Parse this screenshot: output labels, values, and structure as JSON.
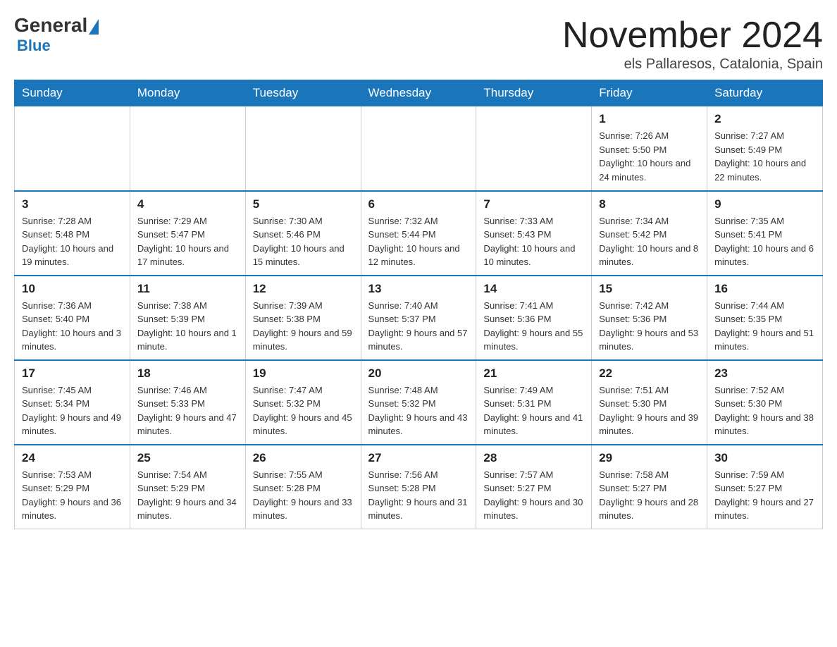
{
  "logo": {
    "general": "General",
    "blue": "Blue"
  },
  "title": "November 2024",
  "location": "els Pallaresos, Catalonia, Spain",
  "weekdays": [
    "Sunday",
    "Monday",
    "Tuesday",
    "Wednesday",
    "Thursday",
    "Friday",
    "Saturday"
  ],
  "weeks": [
    [
      {
        "day": "",
        "sunrise": "",
        "sunset": "",
        "daylight": ""
      },
      {
        "day": "",
        "sunrise": "",
        "sunset": "",
        "daylight": ""
      },
      {
        "day": "",
        "sunrise": "",
        "sunset": "",
        "daylight": ""
      },
      {
        "day": "",
        "sunrise": "",
        "sunset": "",
        "daylight": ""
      },
      {
        "day": "",
        "sunrise": "",
        "sunset": "",
        "daylight": ""
      },
      {
        "day": "1",
        "sunrise": "Sunrise: 7:26 AM",
        "sunset": "Sunset: 5:50 PM",
        "daylight": "Daylight: 10 hours and 24 minutes."
      },
      {
        "day": "2",
        "sunrise": "Sunrise: 7:27 AM",
        "sunset": "Sunset: 5:49 PM",
        "daylight": "Daylight: 10 hours and 22 minutes."
      }
    ],
    [
      {
        "day": "3",
        "sunrise": "Sunrise: 7:28 AM",
        "sunset": "Sunset: 5:48 PM",
        "daylight": "Daylight: 10 hours and 19 minutes."
      },
      {
        "day": "4",
        "sunrise": "Sunrise: 7:29 AM",
        "sunset": "Sunset: 5:47 PM",
        "daylight": "Daylight: 10 hours and 17 minutes."
      },
      {
        "day": "5",
        "sunrise": "Sunrise: 7:30 AM",
        "sunset": "Sunset: 5:46 PM",
        "daylight": "Daylight: 10 hours and 15 minutes."
      },
      {
        "day": "6",
        "sunrise": "Sunrise: 7:32 AM",
        "sunset": "Sunset: 5:44 PM",
        "daylight": "Daylight: 10 hours and 12 minutes."
      },
      {
        "day": "7",
        "sunrise": "Sunrise: 7:33 AM",
        "sunset": "Sunset: 5:43 PM",
        "daylight": "Daylight: 10 hours and 10 minutes."
      },
      {
        "day": "8",
        "sunrise": "Sunrise: 7:34 AM",
        "sunset": "Sunset: 5:42 PM",
        "daylight": "Daylight: 10 hours and 8 minutes."
      },
      {
        "day": "9",
        "sunrise": "Sunrise: 7:35 AM",
        "sunset": "Sunset: 5:41 PM",
        "daylight": "Daylight: 10 hours and 6 minutes."
      }
    ],
    [
      {
        "day": "10",
        "sunrise": "Sunrise: 7:36 AM",
        "sunset": "Sunset: 5:40 PM",
        "daylight": "Daylight: 10 hours and 3 minutes."
      },
      {
        "day": "11",
        "sunrise": "Sunrise: 7:38 AM",
        "sunset": "Sunset: 5:39 PM",
        "daylight": "Daylight: 10 hours and 1 minute."
      },
      {
        "day": "12",
        "sunrise": "Sunrise: 7:39 AM",
        "sunset": "Sunset: 5:38 PM",
        "daylight": "Daylight: 9 hours and 59 minutes."
      },
      {
        "day": "13",
        "sunrise": "Sunrise: 7:40 AM",
        "sunset": "Sunset: 5:37 PM",
        "daylight": "Daylight: 9 hours and 57 minutes."
      },
      {
        "day": "14",
        "sunrise": "Sunrise: 7:41 AM",
        "sunset": "Sunset: 5:36 PM",
        "daylight": "Daylight: 9 hours and 55 minutes."
      },
      {
        "day": "15",
        "sunrise": "Sunrise: 7:42 AM",
        "sunset": "Sunset: 5:36 PM",
        "daylight": "Daylight: 9 hours and 53 minutes."
      },
      {
        "day": "16",
        "sunrise": "Sunrise: 7:44 AM",
        "sunset": "Sunset: 5:35 PM",
        "daylight": "Daylight: 9 hours and 51 minutes."
      }
    ],
    [
      {
        "day": "17",
        "sunrise": "Sunrise: 7:45 AM",
        "sunset": "Sunset: 5:34 PM",
        "daylight": "Daylight: 9 hours and 49 minutes."
      },
      {
        "day": "18",
        "sunrise": "Sunrise: 7:46 AM",
        "sunset": "Sunset: 5:33 PM",
        "daylight": "Daylight: 9 hours and 47 minutes."
      },
      {
        "day": "19",
        "sunrise": "Sunrise: 7:47 AM",
        "sunset": "Sunset: 5:32 PM",
        "daylight": "Daylight: 9 hours and 45 minutes."
      },
      {
        "day": "20",
        "sunrise": "Sunrise: 7:48 AM",
        "sunset": "Sunset: 5:32 PM",
        "daylight": "Daylight: 9 hours and 43 minutes."
      },
      {
        "day": "21",
        "sunrise": "Sunrise: 7:49 AM",
        "sunset": "Sunset: 5:31 PM",
        "daylight": "Daylight: 9 hours and 41 minutes."
      },
      {
        "day": "22",
        "sunrise": "Sunrise: 7:51 AM",
        "sunset": "Sunset: 5:30 PM",
        "daylight": "Daylight: 9 hours and 39 minutes."
      },
      {
        "day": "23",
        "sunrise": "Sunrise: 7:52 AM",
        "sunset": "Sunset: 5:30 PM",
        "daylight": "Daylight: 9 hours and 38 minutes."
      }
    ],
    [
      {
        "day": "24",
        "sunrise": "Sunrise: 7:53 AM",
        "sunset": "Sunset: 5:29 PM",
        "daylight": "Daylight: 9 hours and 36 minutes."
      },
      {
        "day": "25",
        "sunrise": "Sunrise: 7:54 AM",
        "sunset": "Sunset: 5:29 PM",
        "daylight": "Daylight: 9 hours and 34 minutes."
      },
      {
        "day": "26",
        "sunrise": "Sunrise: 7:55 AM",
        "sunset": "Sunset: 5:28 PM",
        "daylight": "Daylight: 9 hours and 33 minutes."
      },
      {
        "day": "27",
        "sunrise": "Sunrise: 7:56 AM",
        "sunset": "Sunset: 5:28 PM",
        "daylight": "Daylight: 9 hours and 31 minutes."
      },
      {
        "day": "28",
        "sunrise": "Sunrise: 7:57 AM",
        "sunset": "Sunset: 5:27 PM",
        "daylight": "Daylight: 9 hours and 30 minutes."
      },
      {
        "day": "29",
        "sunrise": "Sunrise: 7:58 AM",
        "sunset": "Sunset: 5:27 PM",
        "daylight": "Daylight: 9 hours and 28 minutes."
      },
      {
        "day": "30",
        "sunrise": "Sunrise: 7:59 AM",
        "sunset": "Sunset: 5:27 PM",
        "daylight": "Daylight: 9 hours and 27 minutes."
      }
    ]
  ]
}
